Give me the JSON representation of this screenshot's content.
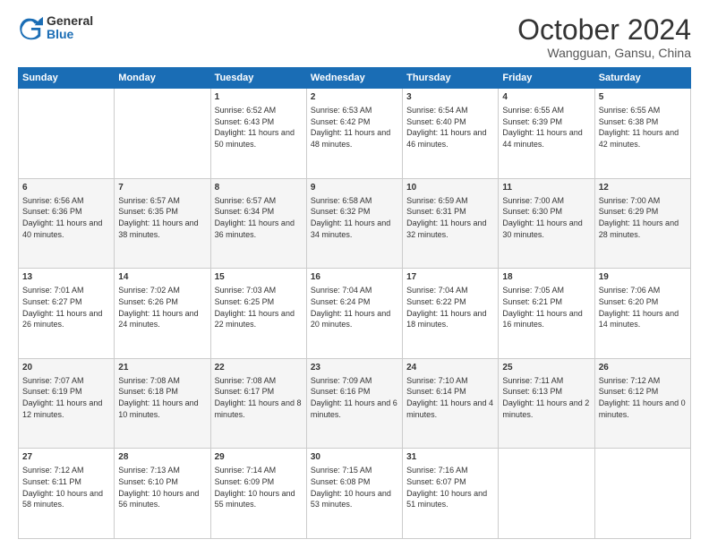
{
  "header": {
    "logo": {
      "general": "General",
      "blue": "Blue"
    },
    "title": "October 2024",
    "location": "Wangguan, Gansu, China"
  },
  "weekdays": [
    "Sunday",
    "Monday",
    "Tuesday",
    "Wednesday",
    "Thursday",
    "Friday",
    "Saturday"
  ],
  "weeks": [
    [
      {
        "day": "",
        "info": ""
      },
      {
        "day": "",
        "info": ""
      },
      {
        "day": "1",
        "info": "Sunrise: 6:52 AM\nSunset: 6:43 PM\nDaylight: 11 hours and 50 minutes."
      },
      {
        "day": "2",
        "info": "Sunrise: 6:53 AM\nSunset: 6:42 PM\nDaylight: 11 hours and 48 minutes."
      },
      {
        "day": "3",
        "info": "Sunrise: 6:54 AM\nSunset: 6:40 PM\nDaylight: 11 hours and 46 minutes."
      },
      {
        "day": "4",
        "info": "Sunrise: 6:55 AM\nSunset: 6:39 PM\nDaylight: 11 hours and 44 minutes."
      },
      {
        "day": "5",
        "info": "Sunrise: 6:55 AM\nSunset: 6:38 PM\nDaylight: 11 hours and 42 minutes."
      }
    ],
    [
      {
        "day": "6",
        "info": "Sunrise: 6:56 AM\nSunset: 6:36 PM\nDaylight: 11 hours and 40 minutes."
      },
      {
        "day": "7",
        "info": "Sunrise: 6:57 AM\nSunset: 6:35 PM\nDaylight: 11 hours and 38 minutes."
      },
      {
        "day": "8",
        "info": "Sunrise: 6:57 AM\nSunset: 6:34 PM\nDaylight: 11 hours and 36 minutes."
      },
      {
        "day": "9",
        "info": "Sunrise: 6:58 AM\nSunset: 6:32 PM\nDaylight: 11 hours and 34 minutes."
      },
      {
        "day": "10",
        "info": "Sunrise: 6:59 AM\nSunset: 6:31 PM\nDaylight: 11 hours and 32 minutes."
      },
      {
        "day": "11",
        "info": "Sunrise: 7:00 AM\nSunset: 6:30 PM\nDaylight: 11 hours and 30 minutes."
      },
      {
        "day": "12",
        "info": "Sunrise: 7:00 AM\nSunset: 6:29 PM\nDaylight: 11 hours and 28 minutes."
      }
    ],
    [
      {
        "day": "13",
        "info": "Sunrise: 7:01 AM\nSunset: 6:27 PM\nDaylight: 11 hours and 26 minutes."
      },
      {
        "day": "14",
        "info": "Sunrise: 7:02 AM\nSunset: 6:26 PM\nDaylight: 11 hours and 24 minutes."
      },
      {
        "day": "15",
        "info": "Sunrise: 7:03 AM\nSunset: 6:25 PM\nDaylight: 11 hours and 22 minutes."
      },
      {
        "day": "16",
        "info": "Sunrise: 7:04 AM\nSunset: 6:24 PM\nDaylight: 11 hours and 20 minutes."
      },
      {
        "day": "17",
        "info": "Sunrise: 7:04 AM\nSunset: 6:22 PM\nDaylight: 11 hours and 18 minutes."
      },
      {
        "day": "18",
        "info": "Sunrise: 7:05 AM\nSunset: 6:21 PM\nDaylight: 11 hours and 16 minutes."
      },
      {
        "day": "19",
        "info": "Sunrise: 7:06 AM\nSunset: 6:20 PM\nDaylight: 11 hours and 14 minutes."
      }
    ],
    [
      {
        "day": "20",
        "info": "Sunrise: 7:07 AM\nSunset: 6:19 PM\nDaylight: 11 hours and 12 minutes."
      },
      {
        "day": "21",
        "info": "Sunrise: 7:08 AM\nSunset: 6:18 PM\nDaylight: 11 hours and 10 minutes."
      },
      {
        "day": "22",
        "info": "Sunrise: 7:08 AM\nSunset: 6:17 PM\nDaylight: 11 hours and 8 minutes."
      },
      {
        "day": "23",
        "info": "Sunrise: 7:09 AM\nSunset: 6:16 PM\nDaylight: 11 hours and 6 minutes."
      },
      {
        "day": "24",
        "info": "Sunrise: 7:10 AM\nSunset: 6:14 PM\nDaylight: 11 hours and 4 minutes."
      },
      {
        "day": "25",
        "info": "Sunrise: 7:11 AM\nSunset: 6:13 PM\nDaylight: 11 hours and 2 minutes."
      },
      {
        "day": "26",
        "info": "Sunrise: 7:12 AM\nSunset: 6:12 PM\nDaylight: 11 hours and 0 minutes."
      }
    ],
    [
      {
        "day": "27",
        "info": "Sunrise: 7:12 AM\nSunset: 6:11 PM\nDaylight: 10 hours and 58 minutes."
      },
      {
        "day": "28",
        "info": "Sunrise: 7:13 AM\nSunset: 6:10 PM\nDaylight: 10 hours and 56 minutes."
      },
      {
        "day": "29",
        "info": "Sunrise: 7:14 AM\nSunset: 6:09 PM\nDaylight: 10 hours and 55 minutes."
      },
      {
        "day": "30",
        "info": "Sunrise: 7:15 AM\nSunset: 6:08 PM\nDaylight: 10 hours and 53 minutes."
      },
      {
        "day": "31",
        "info": "Sunrise: 7:16 AM\nSunset: 6:07 PM\nDaylight: 10 hours and 51 minutes."
      },
      {
        "day": "",
        "info": ""
      },
      {
        "day": "",
        "info": ""
      }
    ]
  ]
}
